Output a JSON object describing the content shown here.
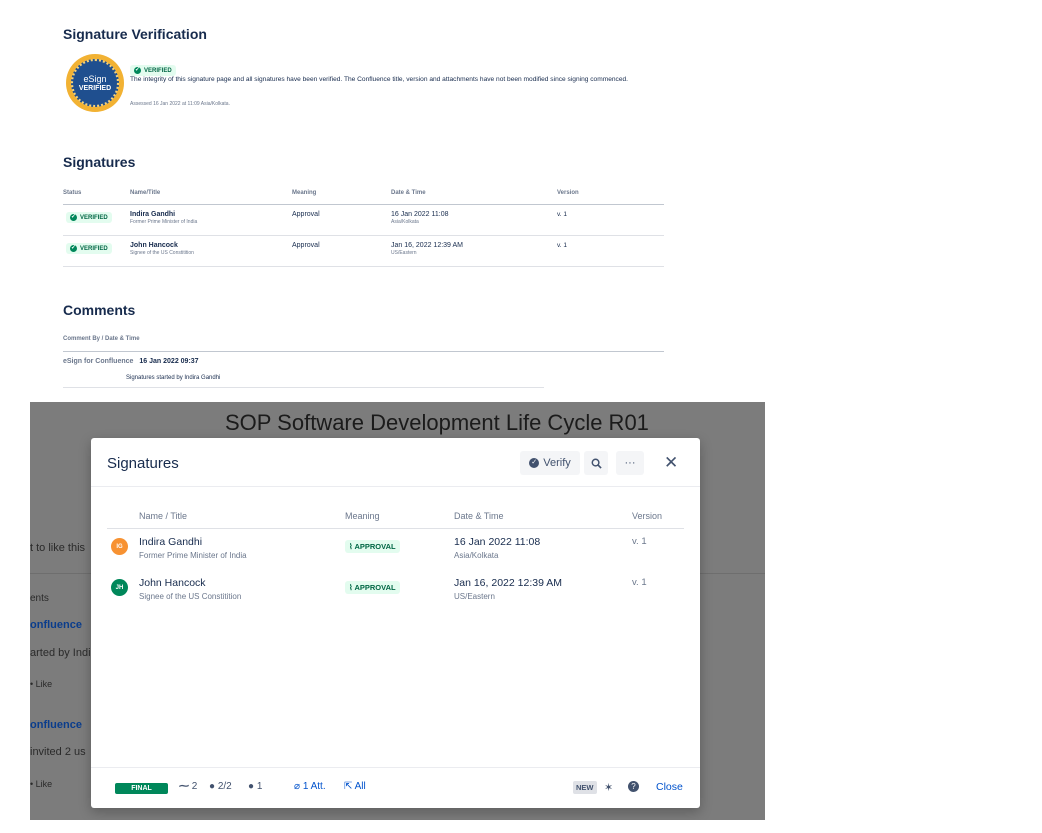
{
  "verification": {
    "title": "Signature Verification",
    "seal_line1": "eSign",
    "seal_line2": "VERIFIED",
    "badge": "VERIFIED",
    "message": "The integrity of this signature page and all signatures have been verified. The Confluence title, version and attachments have not been modified since signing commenced.",
    "assessed": "Assessed 16 Jan 2022 at 11:09 Asia/Kolkata."
  },
  "signatures": {
    "title": "Signatures",
    "headers": [
      "Status",
      "Name/Title",
      "Meaning",
      "Date & Time",
      "Version"
    ],
    "rows": [
      {
        "status": "VERIFIED",
        "name": "Indira Gandhi",
        "role": "Former Prime Minister of India",
        "meaning": "Approval",
        "date": "16 Jan 2022 11:08",
        "tz": "Asia/Kolkata",
        "version": "v. 1"
      },
      {
        "status": "VERIFIED",
        "name": "John Hancock",
        "role": "Signee of the US Constitition",
        "meaning": "Approval",
        "date": "Jan 16, 2022 12:39 AM",
        "tz": "US/Eastern",
        "version": "v. 1"
      }
    ]
  },
  "comments": {
    "title": "Comments",
    "header": "Comment By / Date & Time",
    "author": "eSign for Confluence",
    "date": "16 Jan 2022 09:37",
    "text": "Signatures started by Indira Gandhi"
  },
  "background": {
    "page_title": "SOP Software Development Life Cycle R01",
    "like_text": "t to like this",
    "comments_label": "ents",
    "c1_author": "onfluence",
    "c1_text": "arted by Indi",
    "c1_like": "• Like",
    "c2_author": "onfluence",
    "c2_text": "invited 2 us",
    "c2_like": "• Like"
  },
  "modal": {
    "title": "Signatures",
    "verify_label": "Verify",
    "more_label": "···",
    "close_x": "✕",
    "headers": {
      "name": "Name / Title",
      "meaning": "Meaning",
      "date": "Date & Time",
      "version": "Version"
    },
    "rows": [
      {
        "initials": "IG",
        "avatar_color": "#f79232",
        "name": "Indira Gandhi",
        "role": "Former Prime Minister of India",
        "meaning": "APPROVAL",
        "date": "16 Jan 2022 11:08",
        "tz": "Asia/Kolkata",
        "version": "v. 1"
      },
      {
        "initials": "JH",
        "avatar_color": "#00875a",
        "name": "John Hancock",
        "role": "Signee of the US Constitition",
        "meaning": "APPROVAL",
        "date": "Jan 16, 2022 12:39 AM",
        "tz": "US/Eastern",
        "version": "v. 1"
      }
    ],
    "footer": {
      "status": "FINAL",
      "signature_count": "2",
      "signers": "2/2",
      "watchers": "1",
      "attachments": "1 Att.",
      "all": "All",
      "new_badge": "NEW",
      "close": "Close"
    }
  }
}
